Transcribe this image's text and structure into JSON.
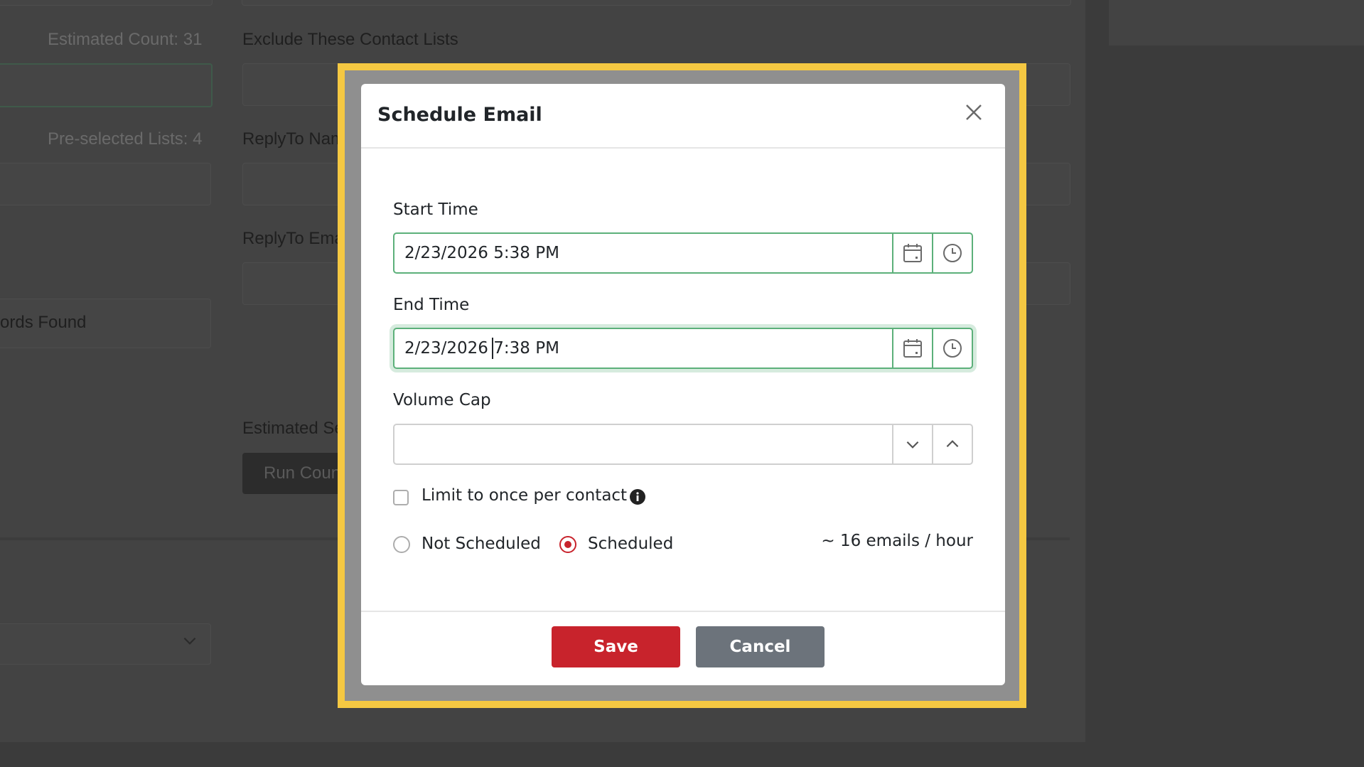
{
  "background": {
    "estimated_count": "Estimated Count: 31",
    "exclude_lists_label": "Exclude These Contact Lists",
    "preselected_lists": "Pre-selected Lists: 4",
    "reply_to_name_label": "ReplyTo Name",
    "reply_to_email_label": "ReplyTo Email",
    "records_found": "ords Found",
    "estimated_send_label": "Estimated Send",
    "run_count_button": "Run Count"
  },
  "modal": {
    "title": "Schedule Email",
    "start_time": {
      "label": "Start Time",
      "value": "2/23/2026 5:38 PM"
    },
    "end_time": {
      "label": "End Time",
      "value": "2/23/2026 7:38 PM"
    },
    "volume_cap": {
      "label": "Volume Cap",
      "value": ""
    },
    "limit_once": {
      "label": "Limit to once per contact",
      "checked": false
    },
    "schedule_options": [
      {
        "label": "Not Scheduled",
        "selected": false
      },
      {
        "label": "Scheduled",
        "selected": true
      }
    ],
    "rate": "~ 16 emails / hour",
    "save_label": "Save",
    "cancel_label": "Cancel"
  },
  "icons": {
    "close": "close-icon",
    "calendar": "calendar-icon",
    "clock": "clock-icon",
    "chevron_down": "chevron-down-icon",
    "chevron_up": "chevron-up-icon",
    "info": "info-icon"
  },
  "colors": {
    "highlight": "#f5c842",
    "input_valid": "#5cb07a",
    "primary_red": "#c8232c",
    "secondary_gray": "#6c737b"
  }
}
